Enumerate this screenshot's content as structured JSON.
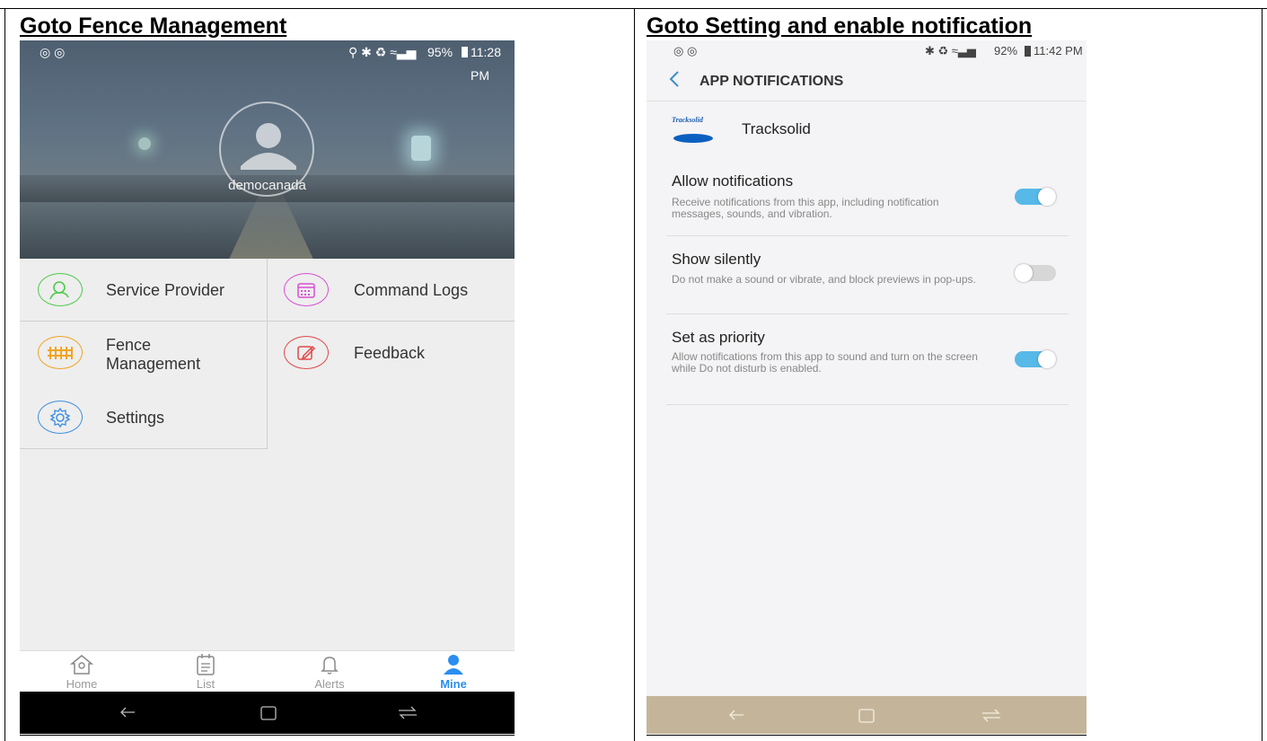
{
  "captions": {
    "left": "Goto Fence Management",
    "right": "Goto Setting and enable notification"
  },
  "left_phone": {
    "status_bar": {
      "battery": "95%",
      "time": "11:28 PM"
    },
    "profile": {
      "username": "democanada"
    },
    "menu": [
      {
        "label": "Service Provider",
        "icon": "person-icon",
        "color": "#4ecb4b"
      },
      {
        "label": "Command Logs",
        "icon": "calendar-icon",
        "color": "#d94fd3"
      },
      {
        "label": "Fence\nManagement",
        "icon": "fence-icon",
        "color": "#f0a422"
      },
      {
        "label": "Feedback",
        "icon": "edit-icon",
        "color": "#e24848"
      },
      {
        "label": "Settings",
        "icon": "gear-icon",
        "color": "#3e90e2"
      }
    ],
    "tabs": [
      {
        "label": "Home",
        "icon": "home-icon"
      },
      {
        "label": "List",
        "icon": "list-icon"
      },
      {
        "label": "Alerts",
        "icon": "bell-icon"
      },
      {
        "label": "Mine",
        "icon": "user-icon",
        "active": true
      }
    ],
    "active_color": "#2a8ef0"
  },
  "right_phone": {
    "status_bar": {
      "battery": "92%",
      "time": "11:42 PM"
    },
    "header": {
      "title": "APP NOTIFICATIONS"
    },
    "app": {
      "name": "Tracksolid",
      "logo_text": "Tracksolid"
    },
    "settings": [
      {
        "title": "Allow notifications",
        "desc": "Receive notifications from this app, including notification messages, sounds, and vibration.",
        "on": true
      },
      {
        "title": "Show silently",
        "desc": "Do not make a sound or vibrate, and block previews in pop-ups.",
        "on": false
      },
      {
        "title": "Set as priority",
        "desc": "Allow notifications from this app to sound and turn on the screen while Do not disturb is enabled.",
        "on": true
      }
    ],
    "toggle_on_color": "#57b9e8",
    "toggle_off_color": "#d7d7d7"
  }
}
